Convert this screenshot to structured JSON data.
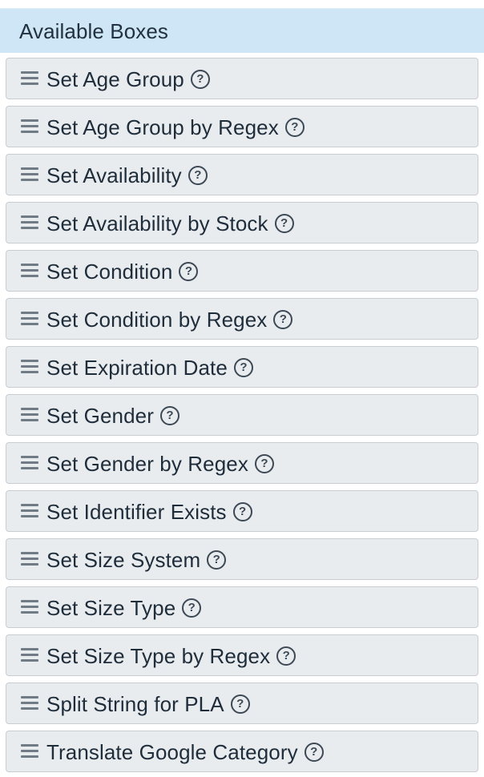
{
  "panel": {
    "title": "Available Boxes"
  },
  "boxes": [
    {
      "label": "Set Age Group",
      "help": "?"
    },
    {
      "label": "Set Age Group by Regex",
      "help": "?"
    },
    {
      "label": "Set Availability",
      "help": "?"
    },
    {
      "label": "Set Availability by Stock",
      "help": "?"
    },
    {
      "label": "Set Condition",
      "help": "?"
    },
    {
      "label": "Set Condition by Regex",
      "help": "?"
    },
    {
      "label": "Set Expiration Date",
      "help": "?"
    },
    {
      "label": "Set Gender",
      "help": "?"
    },
    {
      "label": "Set Gender by Regex",
      "help": "?"
    },
    {
      "label": "Set Identifier Exists",
      "help": "?"
    },
    {
      "label": "Set Size System",
      "help": "?"
    },
    {
      "label": "Set Size Type",
      "help": "?"
    },
    {
      "label": "Set Size Type by Regex",
      "help": "?"
    },
    {
      "label": "Split String for PLA",
      "help": "?"
    },
    {
      "label": "Translate Google Category",
      "help": "?"
    }
  ],
  "icons": {
    "handle": "drag-handle-icon",
    "help": "question-circle-icon"
  },
  "colors": {
    "header_bg": "#cfe6f7",
    "box_bg": "#e9ecef",
    "box_border": "#c9ced3",
    "text": "#1f2d3b"
  }
}
